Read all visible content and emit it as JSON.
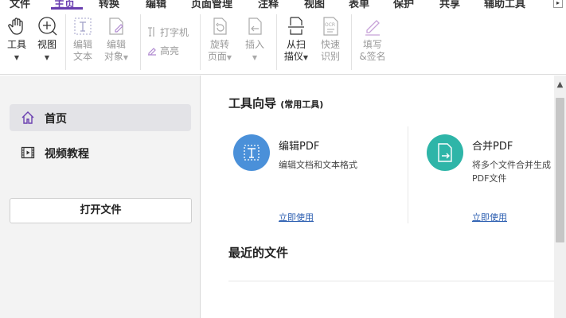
{
  "menu": {
    "tabs": [
      "文件",
      "主页",
      "转换",
      "编辑",
      "页面管理",
      "注释",
      "视图",
      "表单",
      "保护",
      "共享",
      "辅助工具"
    ],
    "active_tab": "主页"
  },
  "ribbon": {
    "tool": {
      "label": "工具"
    },
    "view": {
      "label": "视图"
    },
    "edit_text": {
      "label": "编辑\n文本"
    },
    "edit_object": {
      "label": "编辑\n对象"
    },
    "typewriter": {
      "label": "打字机"
    },
    "highlight": {
      "label": "高亮"
    },
    "rotate": {
      "label": "旋转\n页面"
    },
    "insert": {
      "label": "插入"
    },
    "scan": {
      "label": "从扫\n描仪"
    },
    "ocr": {
      "label": "快速\n识别"
    },
    "fill_sign": {
      "label": "填写\n&签名"
    }
  },
  "sidebar": {
    "items": [
      {
        "label": "首页",
        "icon": "home-icon"
      },
      {
        "label": "视频教程",
        "icon": "video-icon"
      }
    ],
    "open_file": "打开文件"
  },
  "main": {
    "tools_title": "工具向导",
    "tools_subtitle": "(常用工具)",
    "tools": [
      {
        "name": "编辑PDF",
        "desc1": "编辑文档和文本格式",
        "desc2": "",
        "use": "立即使用",
        "color": "#4a90d9"
      },
      {
        "name": "合并PDF",
        "desc1": "将多个文件合并生成",
        "desc2": "PDF文件",
        "use": "立即使用",
        "color": "#2eb5a8"
      }
    ],
    "recent_title": "最近的文件"
  },
  "colors": {
    "accent": "#6a3fb0",
    "link": "#2a5db0"
  }
}
